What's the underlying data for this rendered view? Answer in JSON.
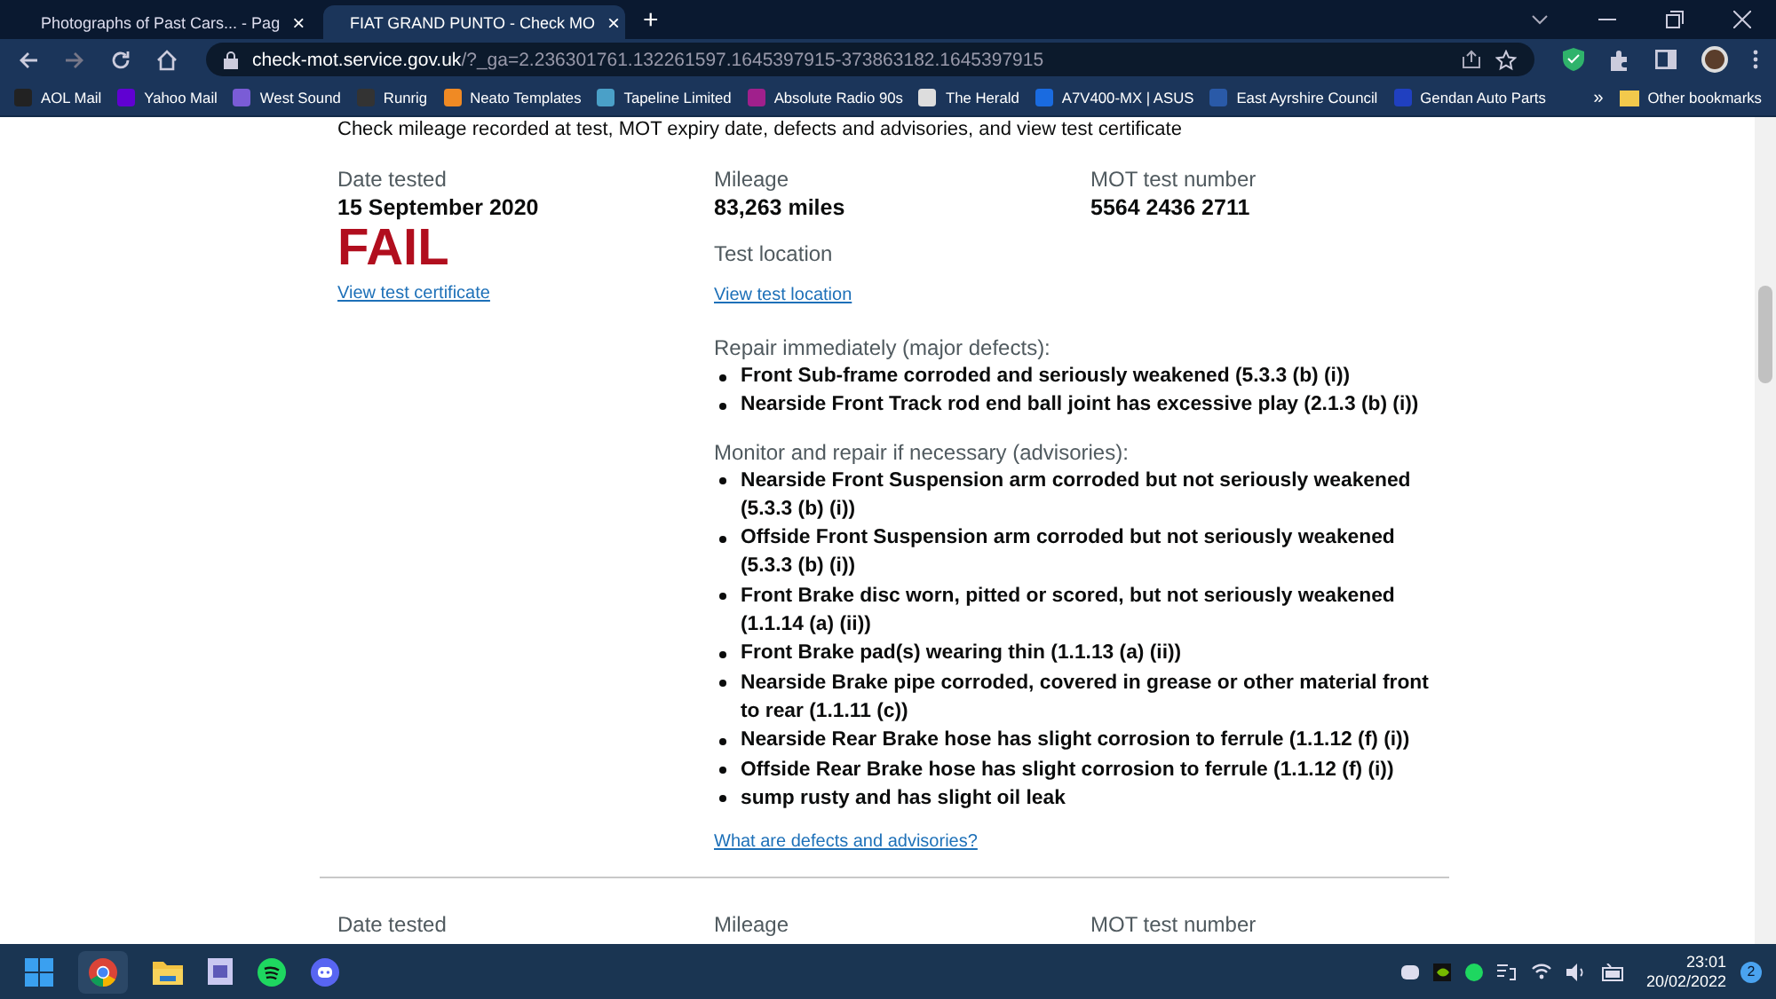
{
  "tabs": [
    {
      "title": "Photographs of Past Cars... - Pag",
      "selected": false,
      "close": "×"
    },
    {
      "title": "FIAT GRAND PUNTO - Check MO",
      "selected": true,
      "close": "×"
    }
  ],
  "new_tab": "+",
  "address": {
    "host": "check-mot.service.gov.uk",
    "path": "/?_ga=2.236301761.132261597.1645397915-373863182.1645397915"
  },
  "bookmarks": [
    {
      "label": "AOL Mail",
      "color": "#222222"
    },
    {
      "label": "Yahoo Mail",
      "color": "#6001d2"
    },
    {
      "label": "West Sound",
      "color": "#7a5cd6"
    },
    {
      "label": "Runrig",
      "color": "#333333"
    },
    {
      "label": "Neato Templates",
      "color": "#f08a24"
    },
    {
      "label": "Tapeline Limited",
      "color": "#4aa0c8"
    },
    {
      "label": "Absolute Radio 90s",
      "color": "#a0208c"
    },
    {
      "label": "The Herald",
      "color": "#dddddd"
    },
    {
      "label": "A7V400-MX | ASUS",
      "color": "#1a6be0"
    },
    {
      "label": "East Ayrshire Council",
      "color": "#2a5aa8"
    },
    {
      "label": "Gendan Auto Parts",
      "color": "#2040c0"
    }
  ],
  "more_bookmarks": "»",
  "other_bookmarks": "Other bookmarks",
  "intro": "Check mileage recorded at test, MOT expiry date, defects and advisories, and view test certificate",
  "test": {
    "date_label": "Date tested",
    "date": "15 September 2020",
    "result": "FAIL",
    "certificate_link": "View test certificate",
    "mileage_label": "Mileage",
    "mileage": "83,263 miles",
    "location_label": "Test location",
    "location_link": "View test location",
    "number_label": "MOT test number",
    "number": "5564 2436 2711",
    "defect_groups": [
      {
        "heading": "Repair immediately (major defects):",
        "items": [
          "Front Sub-frame corroded and seriously weakened (5.3.3 (b) (i))",
          "Nearside Front Track rod end ball joint has excessive play (2.1.3 (b) (i))"
        ]
      },
      {
        "heading": "Monitor and repair if necessary (advisories):",
        "items": [
          "Nearside Front Suspension arm corroded but not seriously weakened (5.3.3 (b) (i))",
          "Offside Front Suspension arm corroded but not seriously weakened (5.3.3 (b) (i))",
          "Front Brake disc worn, pitted or scored, but not seriously weakened (1.1.14 (a) (ii))",
          "Front Brake pad(s) wearing thin (1.1.13 (a) (ii))",
          "Nearside Brake pipe corroded, covered in grease or other material front to rear (1.1.11 (c))",
          "Nearside Rear Brake hose has slight corrosion to ferrule (1.1.12 (f) (i))",
          "Offside Rear Brake hose has slight corrosion to ferrule (1.1.12 (f) (i))",
          "sump rusty and has slight oil leak"
        ]
      }
    ],
    "defects_link": "What are defects and advisories?"
  },
  "next_test": {
    "date_label": "Date tested",
    "mileage_label": "Mileage",
    "number_label": "MOT test number"
  },
  "clock": {
    "time": "23:01",
    "date": "20/02/2022"
  },
  "notifications": "2"
}
